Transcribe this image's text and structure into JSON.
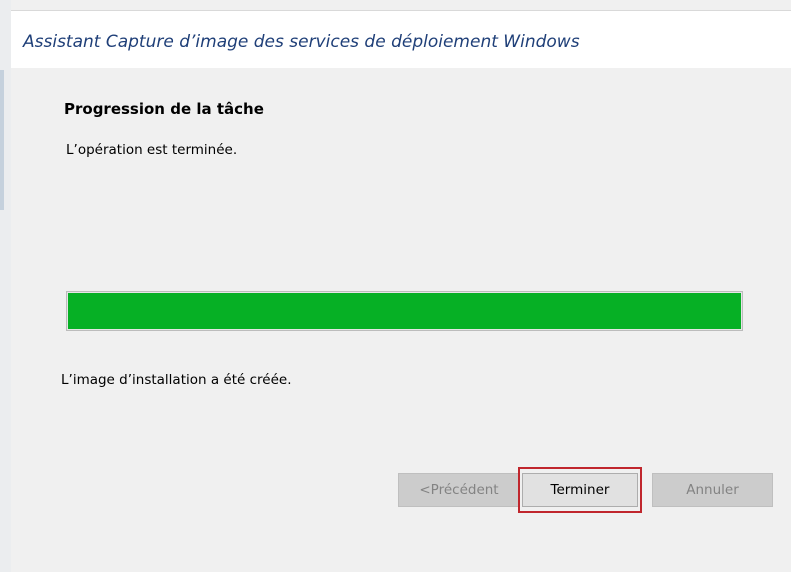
{
  "window": {
    "title": "Assistant Capture d’image des services de déploiement Windows"
  },
  "task": {
    "heading": "Progression de la tâche",
    "status": "L’opération est terminée.",
    "progress_percent": 100,
    "result": "L’image d’installation a été créée."
  },
  "buttons": {
    "previous": "<Précédent",
    "finish": "Terminer",
    "cancel": "Annuler"
  },
  "colors": {
    "progress": "#06b025",
    "title": "#1f3f78",
    "highlight": "#c0262d"
  }
}
